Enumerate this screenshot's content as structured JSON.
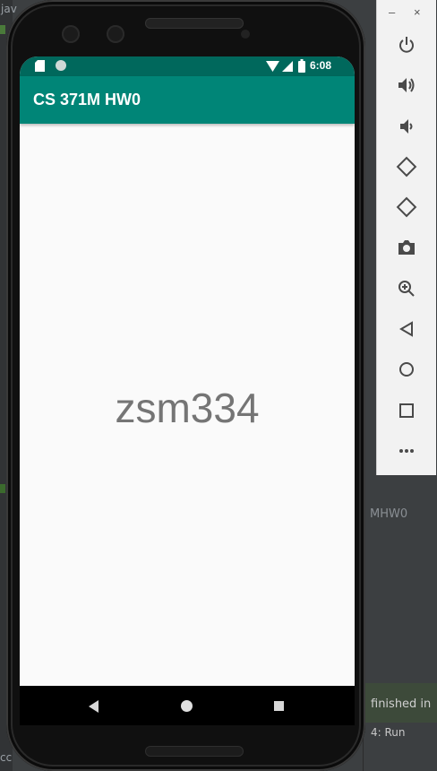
{
  "ide": {
    "left_fragments": [
      "jav",
      "cc"
    ],
    "right_label": "MHW0",
    "status_text": "finished in",
    "run_tab": "4: Run"
  },
  "emulator": {
    "window_controls": [
      "–",
      "×"
    ],
    "toolbar_items": [
      "power",
      "volume-up",
      "volume-down",
      "rotate-left",
      "rotate-right",
      "screenshot",
      "zoom",
      "back",
      "home",
      "overview",
      "more"
    ]
  },
  "phone": {
    "statusbar": {
      "time": "6:08"
    },
    "appbar": {
      "title": "CS 371M HW0"
    },
    "main_text": "zsm334"
  },
  "colors": {
    "appbar": "#008577",
    "statusbar": "#00685c",
    "text": "#757575"
  }
}
